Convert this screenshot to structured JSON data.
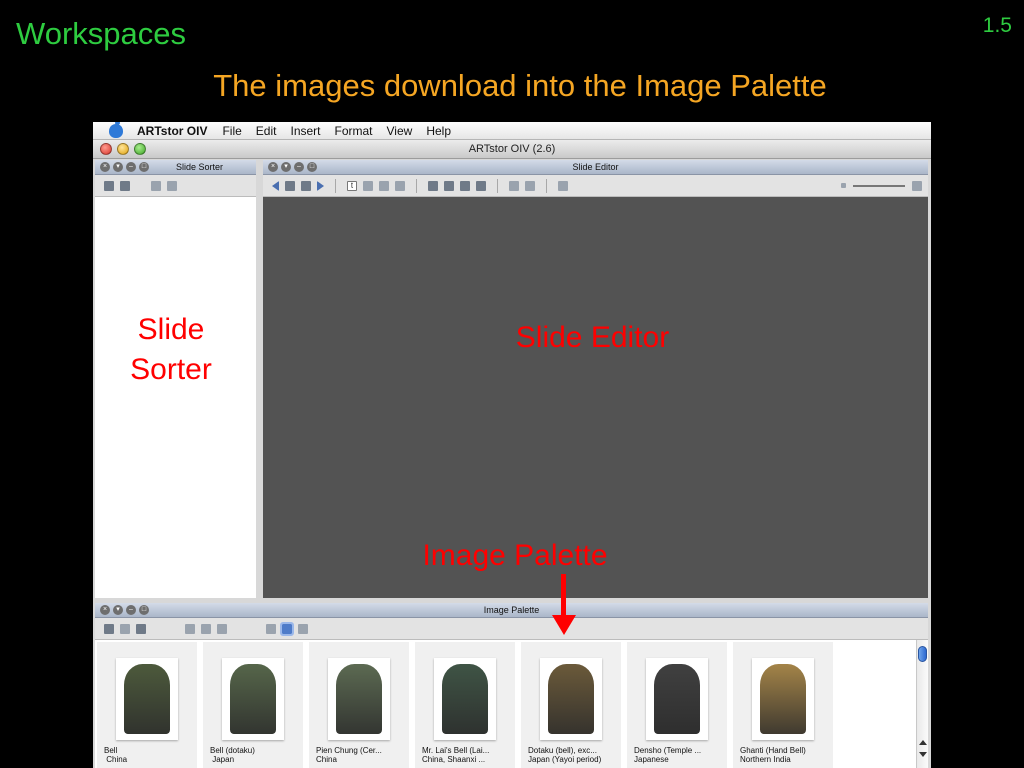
{
  "slide": {
    "heading": "Workspaces",
    "number": "1.5",
    "subtitle": "The images download into the Image Palette"
  },
  "menubar": {
    "app_name": "ARTstor OIV",
    "items": [
      "File",
      "Edit",
      "Insert",
      "Format",
      "View",
      "Help"
    ]
  },
  "window": {
    "title": "ARTstor OIV (2.6)"
  },
  "panels": {
    "slide_sorter": {
      "title": "Slide Sorter"
    },
    "slide_editor": {
      "title": "Slide Editor"
    },
    "image_palette": {
      "title": "Image Palette"
    }
  },
  "annotations": {
    "slide_sorter": [
      "Slide",
      "Sorter"
    ],
    "slide_editor": "Slide Editor",
    "image_palette": "Image Palette"
  },
  "thumbnails": [
    {
      "line1": "Bell",
      "line2": " China",
      "color": "#4d5a3c"
    },
    {
      "line1": "Bell (dotaku)",
      "line2": " Japan",
      "color": "#56664a"
    },
    {
      "line1": "Pien Chung (Cer...",
      "line2": "China",
      "color": "#5c6a52"
    },
    {
      "line1": "Mr. Lai's Bell (Lai...",
      "line2": "China, Shaanxi ...",
      "color": "#3f5445"
    },
    {
      "line1": "Dotaku (bell), exc...",
      "line2": "Japan (Yayoi period)",
      "color": "#6b5a3a"
    },
    {
      "line1": "Densho (Temple ...",
      "line2": "Japanese",
      "color": "#404040"
    },
    {
      "line1": "Ghanti (Hand Bell)",
      "line2": "Northern India",
      "color": "#a48448"
    }
  ],
  "colors": {
    "heading": "#2ecc40",
    "subtitle": "#f5a623",
    "annotation": "#ff0000",
    "editor_canvas": "#535353"
  },
  "icons": {
    "apple": "apple-icon",
    "window_controls": [
      "close-dot",
      "minimize-dot",
      "zoom-dot"
    ],
    "palette_views": [
      "grid-small-icon",
      "grid-large-icon",
      "list-view-icon"
    ],
    "palette_selected_view": "grid-large-icon"
  }
}
